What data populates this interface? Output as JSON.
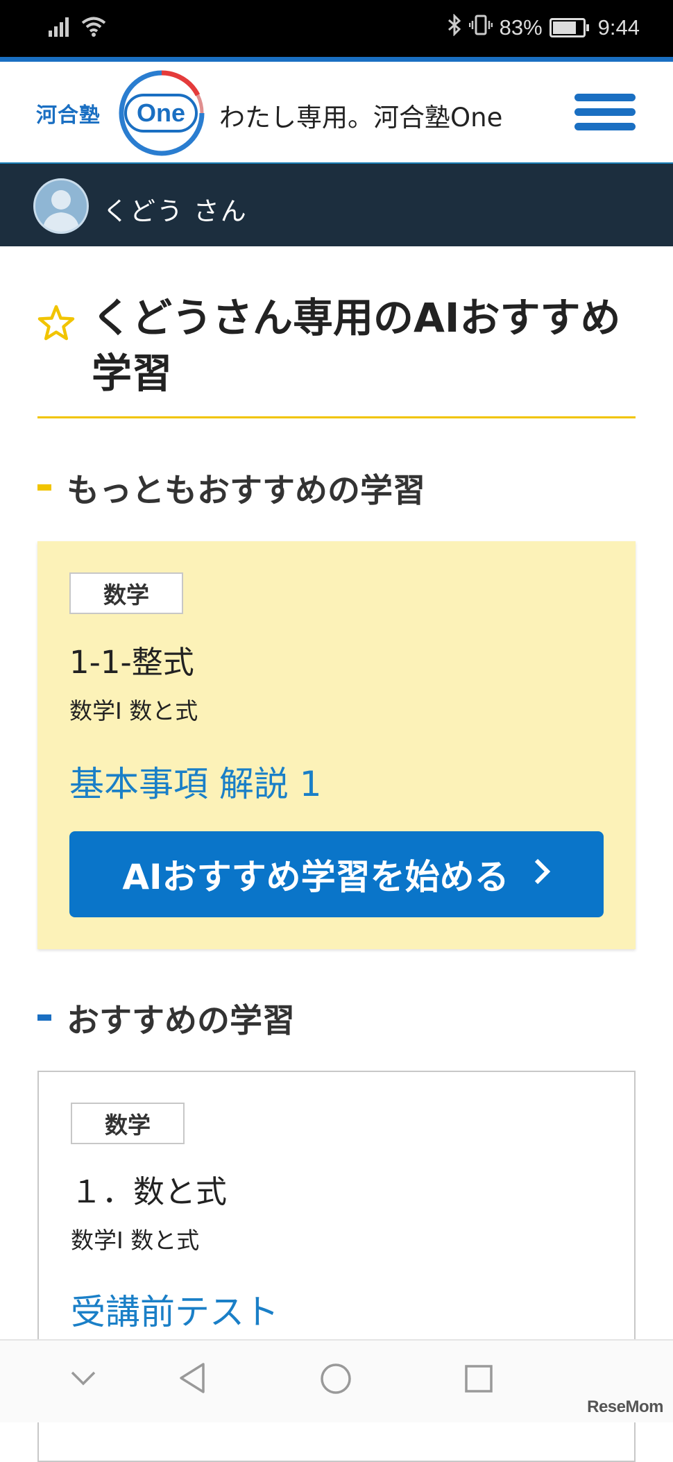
{
  "status_bar": {
    "battery": "83%",
    "battery_level": 0.83,
    "time": "9:44",
    "icons": [
      "signal-icon",
      "wifi-icon",
      "bluetooth-icon",
      "vibrate-icon",
      "battery-icon"
    ]
  },
  "header": {
    "logo_brand": "河合塾",
    "logo_product": "One",
    "title": "わたし専用。河合塾One",
    "menu_icon": "hamburger-menu-icon"
  },
  "user": {
    "name": "くどう さん",
    "avatar_icon": "user-avatar-icon"
  },
  "page": {
    "heading": "くどうさん専用のAIおすすめ学習",
    "heading_icon": "star-icon"
  },
  "sections": {
    "top": {
      "title": "もっともおすすめの学習",
      "marker_color": "#f1c400",
      "card": {
        "badge": "数学",
        "title": "1-1-整式",
        "subtitle": "数学I 数と式",
        "link": "基本事項 解説 1",
        "button": "AIおすすめ学習を始める",
        "button_icon": "chevron-right-icon"
      }
    },
    "recommended": {
      "title": "おすすめの学習",
      "marker_color": "#1a6fc2",
      "card": {
        "badge": "数学",
        "title": "１．数と式",
        "subtitle": "数学I 数と式",
        "link": "受講前テスト"
      }
    }
  },
  "nav_bar": {
    "buttons": [
      "chevron-down-icon",
      "back-icon",
      "home-icon",
      "recents-icon"
    ]
  },
  "watermark": "ReseMom",
  "colors": {
    "accent_blue": "#0a75c9",
    "link_blue": "#1a7fc7",
    "featured_card_bg": "#fcf2b8",
    "user_bar_bg": "#1c2e3e",
    "rule_yellow": "#f1c400"
  }
}
